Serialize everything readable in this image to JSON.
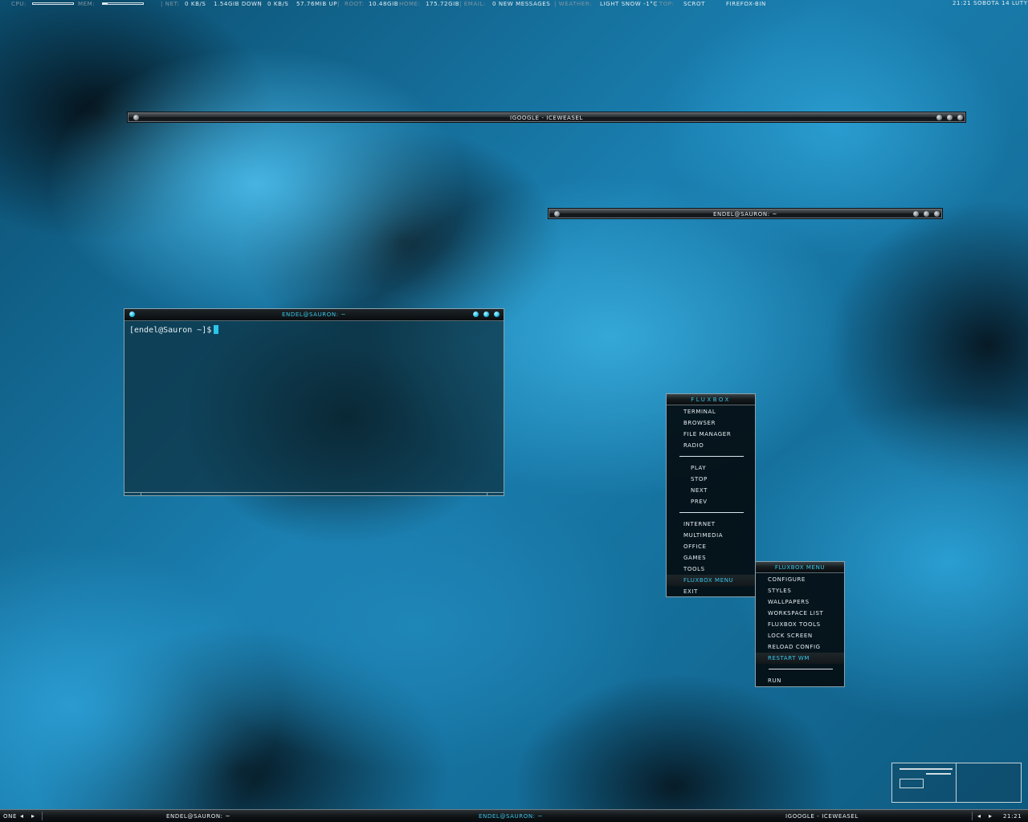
{
  "topbar": {
    "cpu_label": "CPU:",
    "cpu_level": 0,
    "mem_label": "MEM:",
    "mem_level": 0.12,
    "net_label": "| NET:",
    "net_down_rate": "0 KB/S",
    "net_down_total": "1.54GIB DOWN",
    "sep1": "|",
    "net_up_rate": "0 KB/S",
    "net_up_total": "57.76MIB UP",
    "sep2": "|",
    "root_label": "ROOT:",
    "root_value": "10.48GIB",
    "home_label": "HOME:",
    "home_value": "175.72GIB",
    "email_label": "| EMAIL:",
    "email_value": "0 NEW MESSAGES",
    "weather_label": "| WEATHER:",
    "weather_value": "LIGHT SNOW -1°C",
    "top_label": "| TOP:",
    "top_value": "SCROT",
    "top_value2": "FIREFOX-BIN",
    "clock": "21:21 SOBOTA 14 LUTY"
  },
  "windows": {
    "iceweasel_title": "IGOOGLE - ICEWEASEL",
    "terminal_shaded_title": "ENDEL@SAURON: ~",
    "terminal_title": "ENDEL@SAURON: ~",
    "terminal_prompt": "[endel@Sauron ~]$"
  },
  "fluxbox_menu": {
    "title": "FLUXBOX",
    "group1": [
      "TERMINAL",
      "BROWSER",
      "FILE MANAGER",
      "RADIO"
    ],
    "group2": [
      "PLAY",
      "STOP",
      "NEXT",
      "PREV"
    ],
    "group3": [
      "INTERNET",
      "MULTIMEDIA",
      "OFFICE",
      "GAMES",
      "TOOLS",
      "FLUXBOX MENU",
      "EXIT"
    ]
  },
  "submenu": {
    "title": "FLUXBOX MENU",
    "items": [
      "CONFIGURE",
      "STYLES",
      "WALLPAPERS",
      "WORKSPACE LIST",
      "FLUXBOX TOOLS",
      "LOCK SCREEN",
      "RELOAD CONFIG",
      "RESTART WM"
    ],
    "after_sep": "RUN"
  },
  "toolbar": {
    "workspace": "ONE",
    "task1": "ENDEL@SAURON: ~",
    "task2": "ENDEL@SAURON: ~",
    "task3": "IGOOGLE - ICEWEASEL",
    "clock": "21:21"
  },
  "colors": {
    "accent": "#38c7ea",
    "text": "#e6eef2",
    "label": "#7f96a2"
  }
}
